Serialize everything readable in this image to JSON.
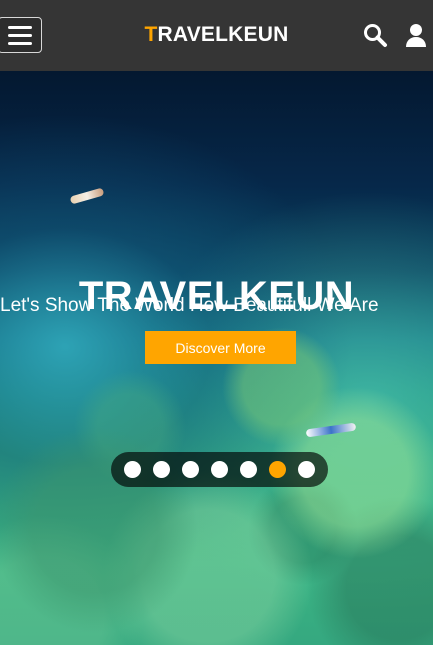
{
  "header": {
    "brand_first": "T",
    "brand_rest": "RAVELKEUN",
    "menu_icon": "hamburger-icon",
    "search_icon": "search-icon",
    "user_icon": "user-icon"
  },
  "hero": {
    "title": "TRAVELKEUN",
    "subtitle": "Let's Show The World How Beautifull We Are",
    "button_label": "Discover More"
  },
  "carousel": {
    "total_slides": 7,
    "active_index": 5
  },
  "colors": {
    "accent": "#ffa500",
    "header_bg": "#353535",
    "text": "#ffffff"
  }
}
